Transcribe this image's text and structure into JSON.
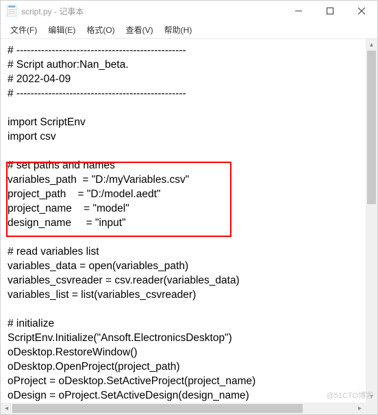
{
  "title": "script.py - 记事本",
  "menu": {
    "file": "文件(F)",
    "edit": "编辑(E)",
    "format": "格式(O)",
    "view": "查看(V)",
    "help": "帮助(H)"
  },
  "content": "# ------------------------------------------------\n# Script author:Nan_beta.\n# 2022-04-09\n# ------------------------------------------------\n\nimport ScriptEnv\nimport csv\n\n# set paths and names\nvariables_path  = \"D:/myVariables.csv\"\nproject_path    = \"D:/model.aedt\"\nproject_name    = \"model\"\ndesign_name     = \"input\"\n\n# read variables list\nvariables_data = open(variables_path)\nvariables_csvreader = csv.reader(variables_data)\nvariables_list = list(variables_csvreader)\n\n# initialize\nScriptEnv.Initialize(\"Ansoft.ElectronicsDesktop\")\noDesktop.RestoreWindow()\noDesktop.OpenProject(project_path)\noProject = oDesktop.SetActiveProject(project_name)\noDesign = oProject.SetActiveDesign(design_name)",
  "watermark": "@51CTO博客"
}
